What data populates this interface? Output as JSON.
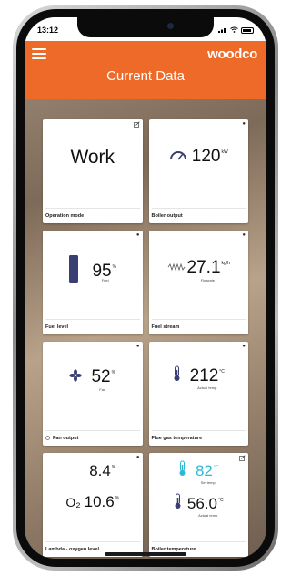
{
  "status": {
    "time": "13:12"
  },
  "header": {
    "logo": "woodco",
    "title": "Current Data"
  },
  "tiles": {
    "operation_mode": {
      "value": "Work",
      "label": "Operation mode"
    },
    "boiler_output": {
      "value": "120",
      "unit": "kW",
      "label": "Boiler output"
    },
    "fuel_level": {
      "value": "95",
      "unit": "%",
      "sub": "Fuel",
      "label": "Fuel level"
    },
    "fuel_stream": {
      "value": "27.1",
      "unit": "kg/h",
      "sub": "Flowrate",
      "label": "Fuel stream"
    },
    "fan_output": {
      "value": "52",
      "unit": "%",
      "sub": "Fan",
      "label": "Fan output"
    },
    "flue_gas": {
      "value": "212",
      "unit": "°C",
      "sub": "Actual temp.",
      "label": "Flue gas temperature"
    },
    "lambda": {
      "value1": "8.4",
      "unit1": "%",
      "value2": "10.6",
      "unit2": "%",
      "o2_symbol": "O₂",
      "label": "Lambda - oxygen level"
    },
    "boiler_temp": {
      "set_value": "82",
      "set_unit": "°C",
      "set_sub": "Set temp.",
      "actual_value": "56.0",
      "actual_unit": "°C",
      "actual_sub": "Actual temp.",
      "label": "Boiler temperature"
    }
  },
  "colors": {
    "accent": "#ee6a29",
    "set_temp": "#2bb8d8",
    "battery_icon": "#3a3f73"
  }
}
